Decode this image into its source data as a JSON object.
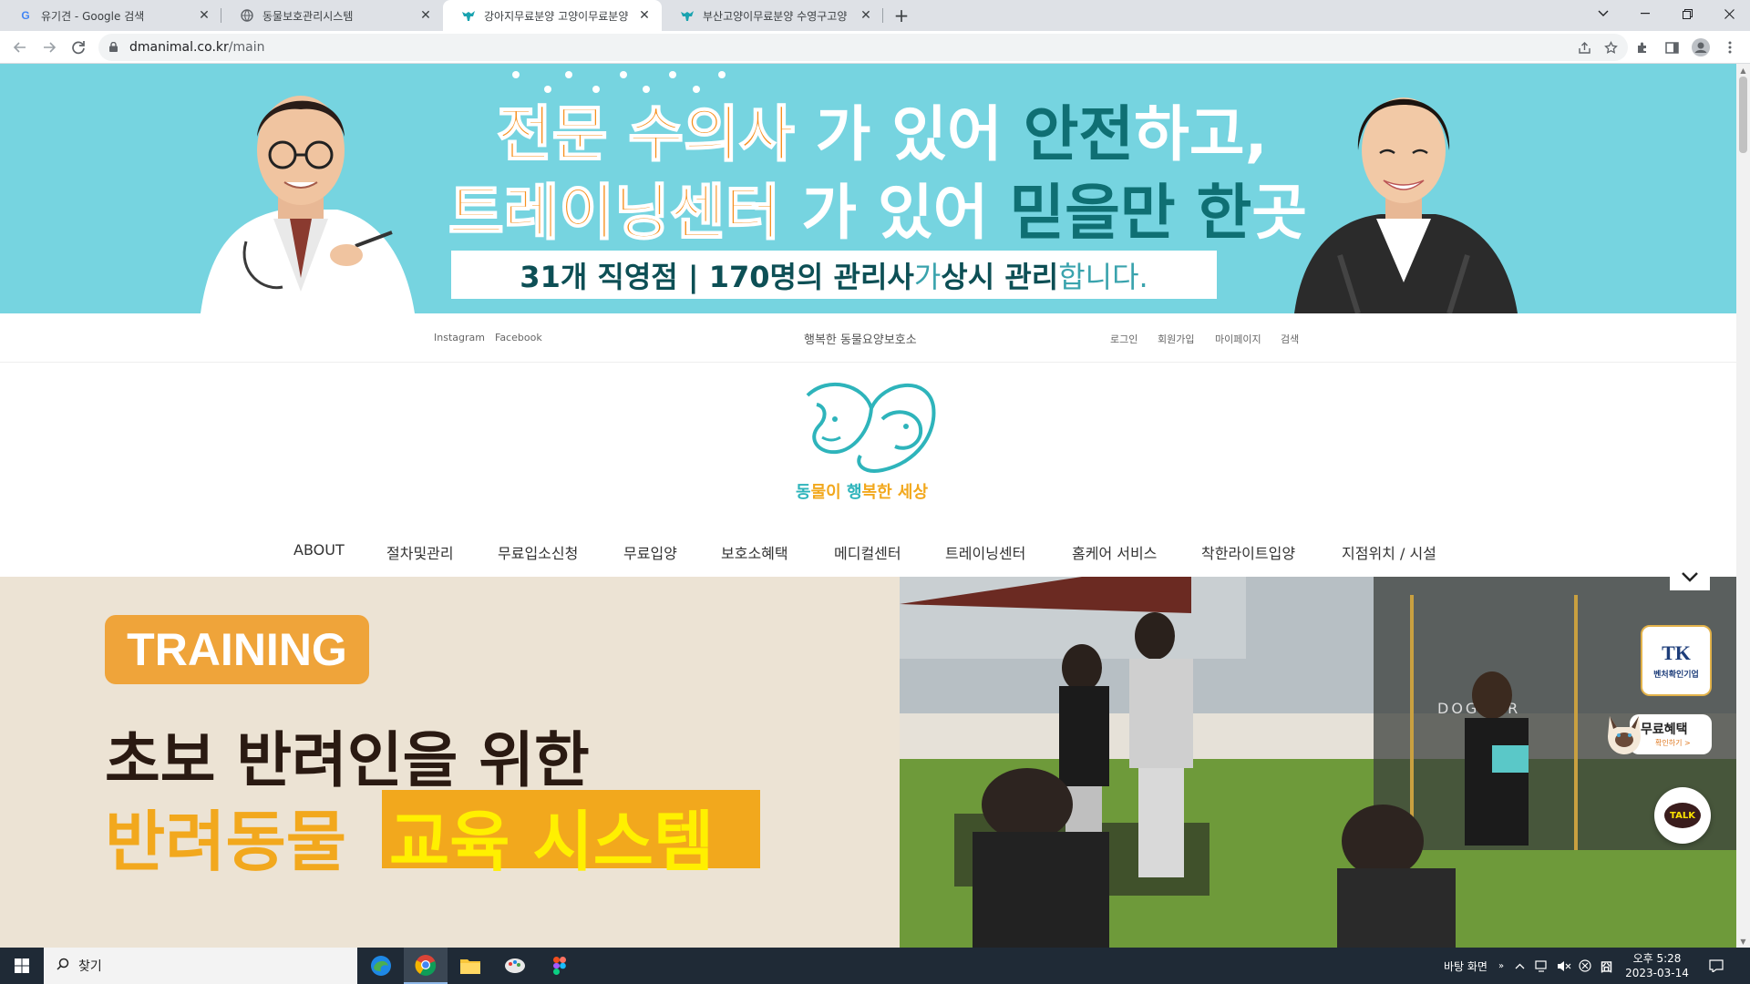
{
  "browser": {
    "tabs": [
      {
        "title": "유기견 - Google 검색",
        "icon": "google-icon",
        "active": false
      },
      {
        "title": "동물보호관리시스템",
        "icon": "globe-icon",
        "active": false
      },
      {
        "title": "강아지무료분양 고양이무료분양",
        "icon": "dog-favicon",
        "active": true
      },
      {
        "title": "부산고양이무료분양 수영구고양",
        "icon": "dog-favicon",
        "active": false
      }
    ],
    "url_domain": "dmanimal.co.kr",
    "url_path": "/main"
  },
  "hero": {
    "line1": [
      {
        "text": "전문 ",
        "style": "orange"
      },
      {
        "text": "수의사",
        "style": "orange"
      },
      {
        "text": " 가 있어 ",
        "style": "white"
      },
      {
        "text": "안전",
        "style": "teal"
      },
      {
        "text": "하고,",
        "style": "white"
      }
    ],
    "line2": [
      {
        "text": "트레이닝센터",
        "style": "orange"
      },
      {
        "text": " 가 있어 ",
        "style": "white"
      },
      {
        "text": "믿을만 한",
        "style": "teal"
      },
      {
        "text": "곳",
        "style": "white"
      }
    ],
    "box_parts": [
      {
        "text": "31개 직영점 | 170명의 관리사",
        "style": "dark"
      },
      {
        "text": "가 ",
        "style": "light"
      },
      {
        "text": "상시 관리",
        "style": "dark"
      },
      {
        "text": "합니다.",
        "style": "light"
      }
    ],
    "colors": {
      "background": "#76d4e0",
      "orange": "#f7901e",
      "teal": "#0f6f73"
    }
  },
  "util": {
    "left_links": [
      "Instagram",
      "Facebook"
    ],
    "center": "행복한 동물요양보호소",
    "right_links": [
      "로그인",
      "회원가입",
      "마이페이지",
      "검색"
    ]
  },
  "logo": {
    "parts": [
      {
        "text": "동",
        "style": "t"
      },
      {
        "text": "물이 ",
        "style": "o"
      },
      {
        "text": "행",
        "style": "t"
      },
      {
        "text": "복한 세상",
        "style": "o"
      }
    ]
  },
  "nav": [
    "ABOUT",
    "절차및관리",
    "무료입소신청",
    "무료입양",
    "보호소혜택",
    "메디컬센터",
    "트레이닝센터",
    "홈케어 서비스",
    "착한라이트입양",
    "지점위치 / 시설"
  ],
  "training": {
    "badge": "TRAINING",
    "heading1": "초보 반려인을 위한",
    "heading2_plain": "반려동물",
    "heading2_highlight": "교육 시스템"
  },
  "photo": {
    "sign_text": "DOGMAR"
  },
  "widgets": {
    "venture_label": "벤처확인기업",
    "free_benefit_title": "무료혜택",
    "free_benefit_sub": "확인하기 >",
    "talk_label": "TALK"
  },
  "taskbar": {
    "search_placeholder": "찾기",
    "desktop_label": "바탕 화면",
    "ime_label": "囧",
    "time": "오후 5:28",
    "date": "2023-03-14"
  }
}
